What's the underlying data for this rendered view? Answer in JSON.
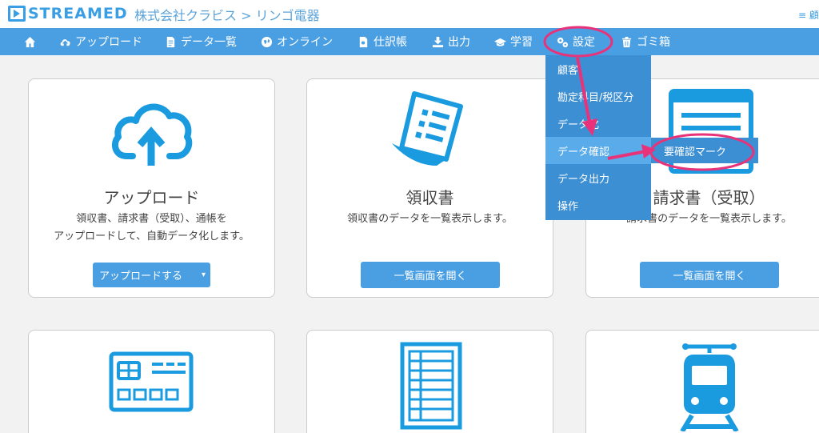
{
  "header": {
    "logo": "STREAMED",
    "company": "株式会社クラビス > リンゴ電器",
    "right_label": "≡ 顧"
  },
  "nav": [
    {
      "label": "",
      "icon": "home-icon"
    },
    {
      "label": "アップロード",
      "icon": "cloud-upload-icon"
    },
    {
      "label": "データ一覧",
      "icon": "document-list-icon"
    },
    {
      "label": "オンライン",
      "icon": "globe-icon"
    },
    {
      "label": "仕訳帳",
      "icon": "ledger-icon"
    },
    {
      "label": "出力",
      "icon": "output-icon"
    },
    {
      "label": "学習",
      "icon": "graduation-cap-icon"
    },
    {
      "label": "設定",
      "icon": "gears-icon"
    },
    {
      "label": "ゴミ箱",
      "icon": "trash-icon"
    }
  ],
  "dropdown": {
    "items": [
      "顧客",
      "勘定科目/税区分",
      "データ化",
      "データ確認",
      "データ出力",
      "操作"
    ],
    "active_index": 3,
    "submenu": "要確認マーク"
  },
  "cards": [
    {
      "title": "アップロード",
      "desc1": "領収書、請求書（受取）、通帳を",
      "desc2": "アップロードして、自動データ化します。",
      "button": "アップロードする",
      "caret": "▾",
      "icon": "cloud-upload-icon"
    },
    {
      "title": "領収書",
      "desc1": "領収書のデータを一覧表示します。",
      "button": "一覧画面を開く",
      "icon": "receipt-icon"
    },
    {
      "title": "請求書（受取）",
      "desc1": "請求書のデータを一覧表示します。",
      "button": "一覧画面を開く",
      "icon": "invoice-icon"
    },
    {
      "icon": "credit-card-icon"
    },
    {
      "icon": "spreadsheet-icon"
    },
    {
      "icon": "train-icon"
    }
  ],
  "colors": {
    "accent": "#4a9fe3",
    "dropdown": "#3d8fd3",
    "annotation": "#e8337a",
    "icon": "#1a9be0"
  }
}
